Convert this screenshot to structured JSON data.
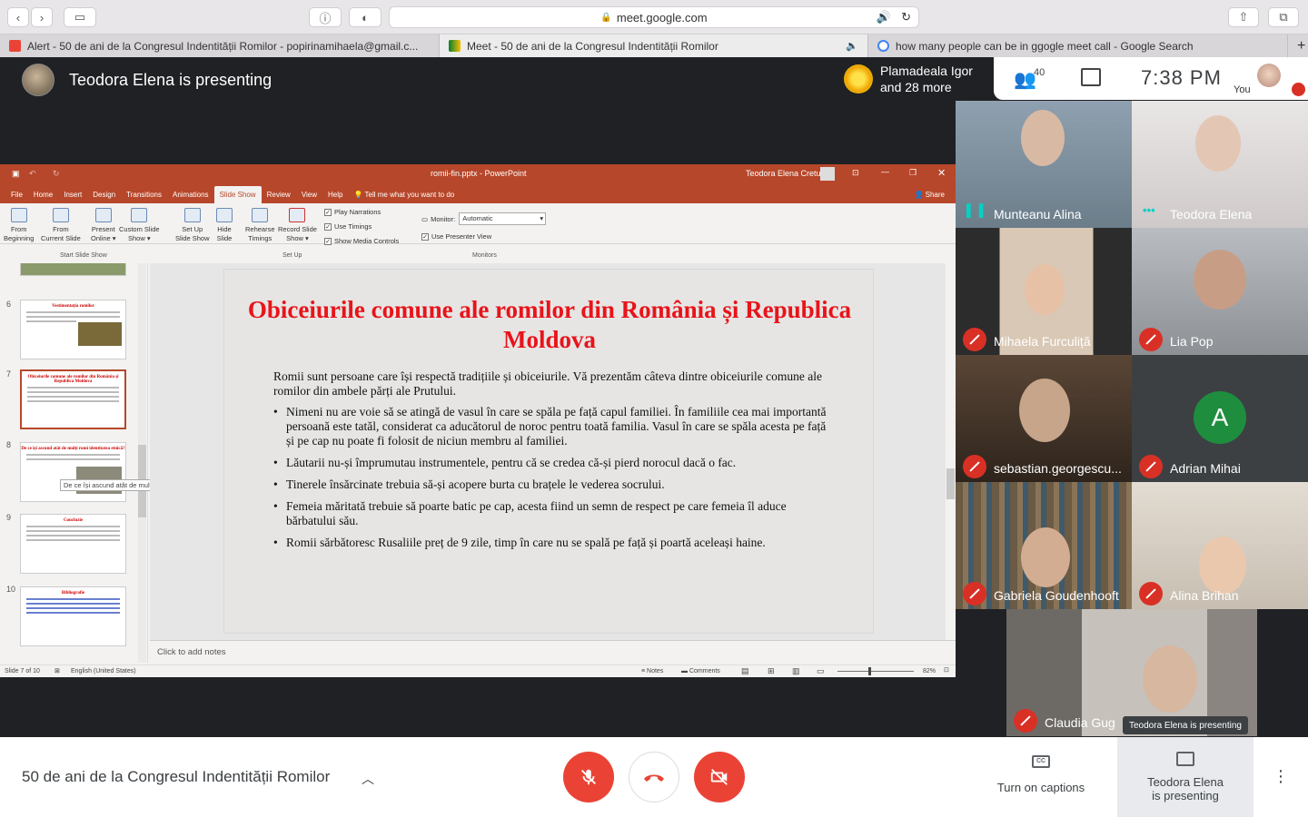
{
  "browser": {
    "url": "meet.google.com",
    "tabs": [
      {
        "label": "Alert - 50 de ani de la Congresul Indentității Romilor - popirinamihaela@gmail.c...",
        "icon": "gmail-icon"
      },
      {
        "label": "Meet - 50 de ani de la Congresul Indentității Romilor",
        "icon": "meet-icon"
      },
      {
        "label": "how many people can be in ggogle meet call - Google Search",
        "icon": "google-icon"
      }
    ]
  },
  "meet": {
    "presenting_title": "Teodora Elena is presenting",
    "join_notice": {
      "line1": "Plamadeala Igor",
      "line2": "and 28 more"
    },
    "participants_count": "40",
    "time": "7:38 PM",
    "you_label": "You",
    "meeting_title": "50 de ani de la Congresul Indentității Romilor",
    "captions_label": "Turn on captions",
    "presenting_button": {
      "line1": "Teodora Elena",
      "line2": "is presenting"
    },
    "presenting_badge": "Teodora Elena is presenting",
    "participants": [
      {
        "name": "Munteanu Alina",
        "muted": false,
        "speaking": true
      },
      {
        "name": "Teodora Elena",
        "muted": false,
        "speaking": false
      },
      {
        "name": "Mihaela Furculiță",
        "muted": true
      },
      {
        "name": "Lia Pop",
        "muted": true
      },
      {
        "name": "sebastian.georgescu...",
        "muted": true
      },
      {
        "name": "Adrian Mihai",
        "muted": true,
        "avatar_letter": "A"
      },
      {
        "name": "Gabriela Goudenhooft",
        "muted": true
      },
      {
        "name": "Alina Brihan",
        "muted": true
      },
      {
        "name": "Claudia Gug",
        "muted": true
      }
    ]
  },
  "powerpoint": {
    "title": "romii-fin.pptx  -  PowerPoint",
    "user": "Teodora Elena Cretu",
    "tabs": [
      "File",
      "Home",
      "Insert",
      "Design",
      "Transitions",
      "Animations",
      "Slide Show",
      "Review",
      "View",
      "Help"
    ],
    "tell_me": "Tell me what you want to do",
    "share": "Share",
    "ribbon": {
      "from_beginning": [
        "From",
        "Beginning"
      ],
      "from_current": [
        "From",
        "Current Slide"
      ],
      "present_online": [
        "Present",
        "Online ▾"
      ],
      "custom_show": [
        "Custom Slide",
        "Show ▾"
      ],
      "start_group": "Start Slide Show",
      "setup_show": [
        "Set Up",
        "Slide Show"
      ],
      "hide_slide": [
        "Hide",
        "Slide"
      ],
      "rehearse": [
        "Rehearse",
        "Timings"
      ],
      "record": [
        "Record Slide",
        "Show ▾"
      ],
      "play_narrations": "Play Narrations",
      "use_timings": "Use Timings",
      "show_media": "Show Media Controls",
      "setup_group": "Set Up",
      "monitor_label": "Monitor:",
      "monitor_value": "Automatic",
      "presenter_view": "Use Presenter View",
      "monitors_group": "Monitors"
    },
    "thumbnails": [
      {
        "num": "6",
        "title": "Vestimentația romilor"
      },
      {
        "num": "7",
        "title": "Obiceiurile comune ale romilor din România și Republica Moldova"
      },
      {
        "num": "8",
        "title": "De ce își ascund atât de mulți romi identitatea etnică?"
      },
      {
        "num": "9",
        "title": "Concluzie"
      },
      {
        "num": "10",
        "title": "Bibliografie"
      }
    ],
    "tooltip": "De ce își ascund atât de mulți ro...",
    "slide": {
      "title": "Obiceiurile comune ale romilor din România și Republica Moldova",
      "intro": "Romii sunt persoane care își respectă tradițiile și obiceiurile. Vă prezentăm câteva dintre obiceiurile comune ale romilor din ambele părți ale Prutului.",
      "bullets": [
        "Nimeni nu are voie să se atingă de vasul în care se spăla pe față capul familiei. În familiile cea mai importantă persoană este tatăl, considerat ca aducătorul de noroc pentru toată familia. Vasul în care se spăla acesta pe față și pe cap nu poate fi folosit de niciun membru al familiei.",
        "Lăutarii nu-și împrumutau instrumentele, pentru că se credea că-și pierd norocul dacă o fac.",
        "Tinerele însărcinate trebuia să-și acopere burta cu brațele le vederea socrului.",
        "Femeia măritată trebuie să poarte batic pe cap, acesta fiind un semn de respect pe care femeia îl aduce bărbatului său.",
        "Romii sărbătoresc Rusaliile preț de 9 zile, timp în care nu se spală pe față și poartă aceleași haine."
      ]
    },
    "notes": "Click to add notes",
    "status": {
      "slide": "Slide 7 of 10",
      "lang": "English (United States)",
      "notes": "Notes",
      "comments": "Comments",
      "zoom": "82%"
    }
  }
}
